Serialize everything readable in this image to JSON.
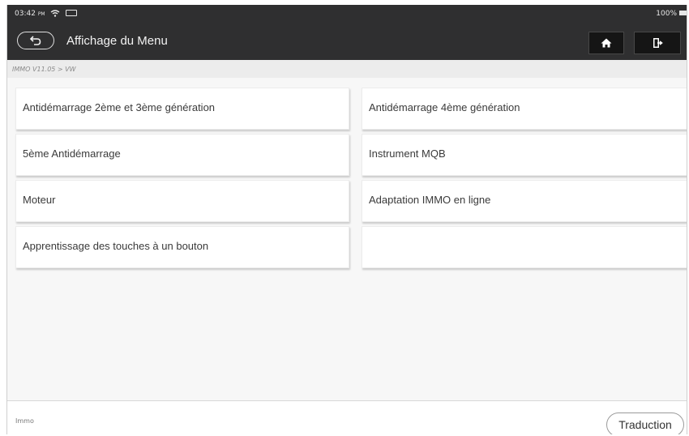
{
  "status_bar": {
    "time": "03:42",
    "ampm": "PM",
    "battery_text": "100%",
    "icons": [
      "wifi-icon",
      "battery-icon"
    ]
  },
  "header": {
    "title": "Affichage du Menu",
    "back_icon": "back-arrow-icon",
    "home_icon": "home-icon",
    "exit_icon": "exit-icon"
  },
  "breadcrumb": "IMMO V11.05 > VW",
  "menu": {
    "items": [
      {
        "label": "Antidémarrage 2ème et 3ème génération"
      },
      {
        "label": "Antidémarrage 4ème génération"
      },
      {
        "label": "5ème Antidémarrage"
      },
      {
        "label": "Instrument MQB"
      },
      {
        "label": "Moteur"
      },
      {
        "label": "Adaptation IMMO en ligne"
      },
      {
        "label": "Apprentissage des touches à un bouton"
      },
      {
        "label": ""
      }
    ]
  },
  "footer": {
    "label": "Immo",
    "translate_label": "Traduction"
  },
  "colors": {
    "topbar": "#2f2f30",
    "breadcrumb_bg": "#ececec",
    "grid_bg": "#f7f7f7"
  }
}
